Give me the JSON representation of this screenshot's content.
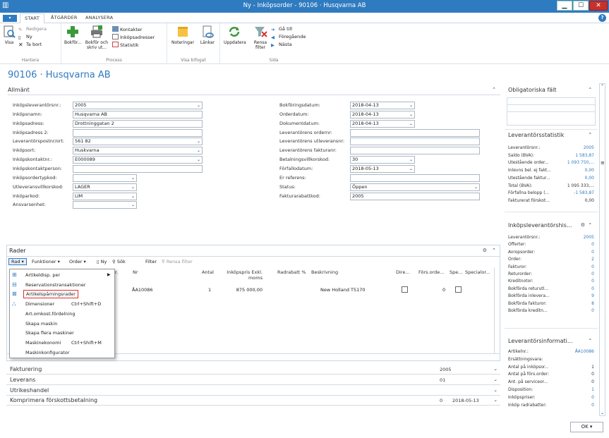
{
  "window": {
    "title": "Ny - Inköpsorder - 90106 · Husqvarna AB",
    "minimize": "▁",
    "maximize": "☐",
    "close": "✕"
  },
  "tabs": [
    "START",
    "ÅTGÄRDER",
    "ANALYSERA"
  ],
  "ribbon": {
    "hantera": {
      "label": "Hantera",
      "visa": "Visa",
      "redigera": "Redigera",
      "ny": "Ny",
      "tabort": "Ta bort"
    },
    "process": {
      "label": "Process",
      "bokfor": "Bokför...",
      "bokforskriv": "Bokför och skriv ut...",
      "kontakter": "Kontakter",
      "inkopsadresser": "Inköpsadresser",
      "statistik": "Statistik"
    },
    "bifogat": {
      "label": "Visa bifogat",
      "noteringar": "Noteringar",
      "lankar": "Länkar"
    },
    "sida": {
      "label": "Sida",
      "uppdatera": "Uppdatera",
      "rensa": "Rensa filter",
      "gatill": "Gå till",
      "foregaende": "Föregående",
      "nasta": "Nästa"
    }
  },
  "page_title": "90106 · Husqvarna AB",
  "allmant": {
    "title": "Allmänt",
    "left": [
      {
        "label": "Inköpsleverantörsnr.:",
        "value": "2005",
        "dd": true
      },
      {
        "label": "Inköpsnamn:",
        "value": "Husqvarna AB",
        "dd": false
      },
      {
        "label": "Inköpsadress:",
        "value": "Drottninggatan 2",
        "dd": false
      },
      {
        "label": "Inköpsadress 2:",
        "value": "",
        "dd": false
      },
      {
        "label": "Leverantörspostnr/ort:",
        "value": "561 82",
        "dd": true
      },
      {
        "label": "Inköpsort:",
        "value": "Huskvarna",
        "dd": true
      },
      {
        "label": "Inköpskontaktnr.:",
        "value": "E000089",
        "dd": true
      },
      {
        "label": "Inköpskontaktperson:",
        "value": "",
        "dd": false
      },
      {
        "label": "Inköpsordertypkod:",
        "value": "",
        "dd": true
      },
      {
        "label": "Utleveransvillkorskod:",
        "value": "LAGER",
        "dd": true
      },
      {
        "label": "Inköparkod:",
        "value": "LIM",
        "dd": true
      },
      {
        "label": "Ansvarsenhet:",
        "value": "",
        "dd": true
      }
    ],
    "right": [
      {
        "label": "Bokföringsdatum:",
        "value": "2018-04-13",
        "dd": true
      },
      {
        "label": "Orderdatum:",
        "value": "2018-04-13",
        "dd": true
      },
      {
        "label": "Dokumentdatum:",
        "value": "2018-04-13",
        "dd": true
      },
      {
        "label": "Leverantörens ordernr:",
        "value": "",
        "dd": false
      },
      {
        "label": "Leverantörens utleveransnr:",
        "value": "",
        "dd": false
      },
      {
        "label": "Leverantörens fakturanr:",
        "value": "",
        "dd": false
      },
      {
        "label": "Betalningsvillkorskod:",
        "value": "30",
        "dd": true
      },
      {
        "label": "Förfallodatum:",
        "value": "2018-05-13",
        "dd": true
      },
      {
        "label": "Er referens:",
        "value": "",
        "dd": false
      },
      {
        "label": "Status:",
        "value": "Öppen",
        "dd": true
      },
      {
        "label": "Fakturarabattkod:",
        "value": "2005",
        "dd": false
      }
    ]
  },
  "rader": {
    "title": "Rader",
    "toolbar": {
      "rad": "Rad",
      "funktioner": "Funktioner",
      "order": "Order",
      "ny": "Ny",
      "sok": "Sök",
      "filter": "Filter",
      "rensa": "Rensa filter"
    },
    "columns": {
      "typ": "r.",
      "nr": "Nr",
      "antal": "Antal",
      "pris": "Inköpspris Exkl.",
      "pris2": "moms",
      "rabatt": "Radrabatt %",
      "beskr": "Beskrivning",
      "dire": "Dire...",
      "fors": "Förs.orde...",
      "spe": "Spe...",
      "spec": "Specialor..."
    },
    "row": {
      "nr": "ÅA10086",
      "antal": "1",
      "pris": "875 000,00",
      "beskr": "New Holland T5170",
      "fors": "0"
    }
  },
  "context_menu": [
    {
      "label": "Artikeldisp. per",
      "shortcut": "",
      "sub": true
    },
    {
      "label": "Reservationstransaktioner",
      "shortcut": "",
      "sub": false
    },
    {
      "label": "Artikelspårningsrader",
      "shortcut": "",
      "sub": false,
      "highlight": true
    },
    {
      "label": "Dimensioner",
      "shortcut": "Ctrl+Shift+D",
      "sub": false
    },
    {
      "label": "Art.omkost.fördelning",
      "shortcut": "",
      "sub": false
    },
    {
      "label": "Skapa maskin",
      "shortcut": "",
      "sub": false
    },
    {
      "label": "Skapa flera maskiner",
      "shortcut": "",
      "sub": false
    },
    {
      "label": "Maskinekonomi",
      "shortcut": "Ctrl+Shift+M",
      "sub": false
    },
    {
      "label": "Maskinkonfigurator",
      "shortcut": "",
      "sub": false
    }
  ],
  "fasttabs": [
    {
      "title": "Fakturering",
      "v1": "2005",
      "v2": ""
    },
    {
      "title": "Leverans",
      "v1": "01",
      "v2": ""
    },
    {
      "title": "Utrikeshandel",
      "v1": "",
      "v2": ""
    },
    {
      "title": "Komprimera förskottsbetalning",
      "v1": "0",
      "v2": "2018-05-13"
    }
  ],
  "factboxes": {
    "oblig": {
      "title": "Obligatoriska fält"
    },
    "levstat": {
      "title": "Leverantörsstatistik",
      "rows": [
        {
          "k": "Leverantörsnr.:",
          "v": "2005",
          "link": true
        },
        {
          "k": "Saldo (BVA):",
          "v": "1 583,87",
          "link": true
        },
        {
          "k": "Utestående order...",
          "v": "1 093 750,...",
          "link": true
        },
        {
          "k": "Inlevns bel. ej fakt...",
          "v": "0,00",
          "link": true
        },
        {
          "k": "Utestående faktur...",
          "v": "0,00",
          "link": true
        },
        {
          "k": "Total (BVA):",
          "v": "1 095 333,...",
          "link": false
        },
        {
          "k": "Förfallna belopp (...",
          "v": "-1 583,87",
          "link": true
        },
        {
          "k": "Fakturerat förskot...",
          "v": "0,00",
          "link": false
        }
      ]
    },
    "levhist": {
      "title": "Inköpsleverantörshis...",
      "rows": [
        {
          "k": "Leverantörsnr.:",
          "v": "2005",
          "link": true
        },
        {
          "k": "Offerter:",
          "v": "0",
          "link": true
        },
        {
          "k": "Avropsorder:",
          "v": "0",
          "link": true
        },
        {
          "k": "Order:",
          "v": "2",
          "link": true
        },
        {
          "k": "Fakturor:",
          "v": "0",
          "link": true
        },
        {
          "k": "Returorder:",
          "v": "0",
          "link": true
        },
        {
          "k": "Kreditnotor:",
          "v": "0",
          "link": true
        },
        {
          "k": "Bokförda returutl...",
          "v": "0",
          "link": true
        },
        {
          "k": "Bokförda inlevera...",
          "v": "9",
          "link": true
        },
        {
          "k": "Bokförda fakturor:",
          "v": "8",
          "link": true
        },
        {
          "k": "Bokförda kreditn...",
          "v": "0",
          "link": true
        }
      ]
    },
    "levinfo": {
      "title": "Leverantörsinformati...",
      "rows": [
        {
          "k": "Artikelnr.:",
          "v": "ÅA10086",
          "link": true
        },
        {
          "k": "Ersättningsvara:",
          "v": "",
          "link": false
        },
        {
          "k": "Antal på inköpsor...",
          "v": "1",
          "link": false
        },
        {
          "k": "Antal på förs.order:",
          "v": "0",
          "link": false
        },
        {
          "k": "Ant. på serviceor...",
          "v": "0",
          "link": false
        },
        {
          "k": "Disposition:",
          "v": "1",
          "link": true
        },
        {
          "k": "Inköpspriser:",
          "v": "0",
          "link": true
        },
        {
          "k": "Inköp radrabatter:",
          "v": "0",
          "link": true
        }
      ]
    }
  },
  "ok_button": "OK",
  "colors": {
    "accent": "#2f7bc0",
    "highlight": "#d9312b"
  }
}
